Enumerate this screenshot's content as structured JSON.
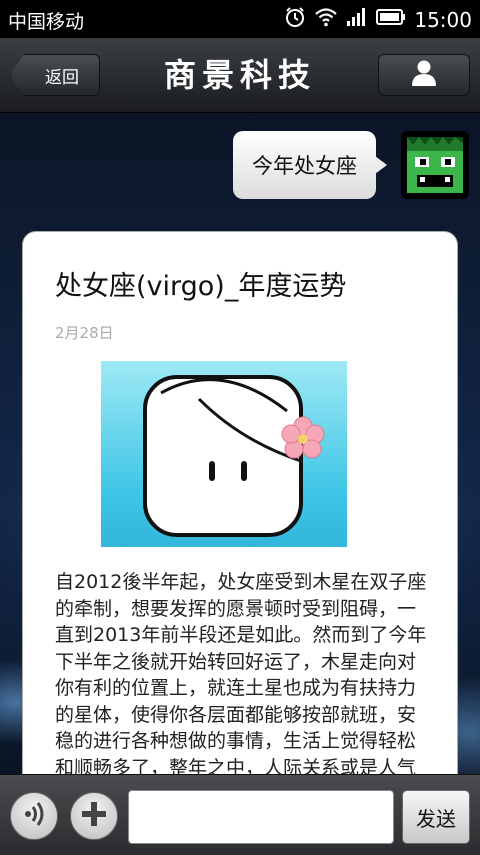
{
  "status_bar": {
    "carrier": "中国移动",
    "time": "15:00",
    "icons": [
      "alarm-icon",
      "wifi-icon",
      "signal-icon",
      "battery-icon"
    ]
  },
  "header": {
    "back_label": "返回",
    "title": "商景科技",
    "profile_icon": "user-icon"
  },
  "chat": {
    "sent_message": "今年处女座",
    "avatar_icon": "green-monster-avatar"
  },
  "article": {
    "title": "处女座(virgo)_年度运势",
    "date": "2月28日",
    "image_icon": "virgo-face-illustration",
    "body": "自2012後半年起，处女座受到木星在双子座的牵制，想要发挥的愿景顿时受到阻碍，一直到2013年前半段还是如此。然而到了今年下半年之後就开始转回好运了，木星走向对你有利的位置上，就连土星也成为有扶持力的星体，使得你各层面都能够按部就班，安稳的进行各种想做的事情，生活上觉得轻松和顺畅多了，整年之中，人际关系或是人气对"
  },
  "input_bar": {
    "voice_icon": "voice-icon",
    "add_icon": "plus-icon",
    "input_value": "",
    "send_label": "发送"
  },
  "colors": {
    "status_bg": "#000000",
    "title_bar": "#2a2d31",
    "image_bg": "#3fc6e6",
    "flower": "#f7a8b8"
  }
}
